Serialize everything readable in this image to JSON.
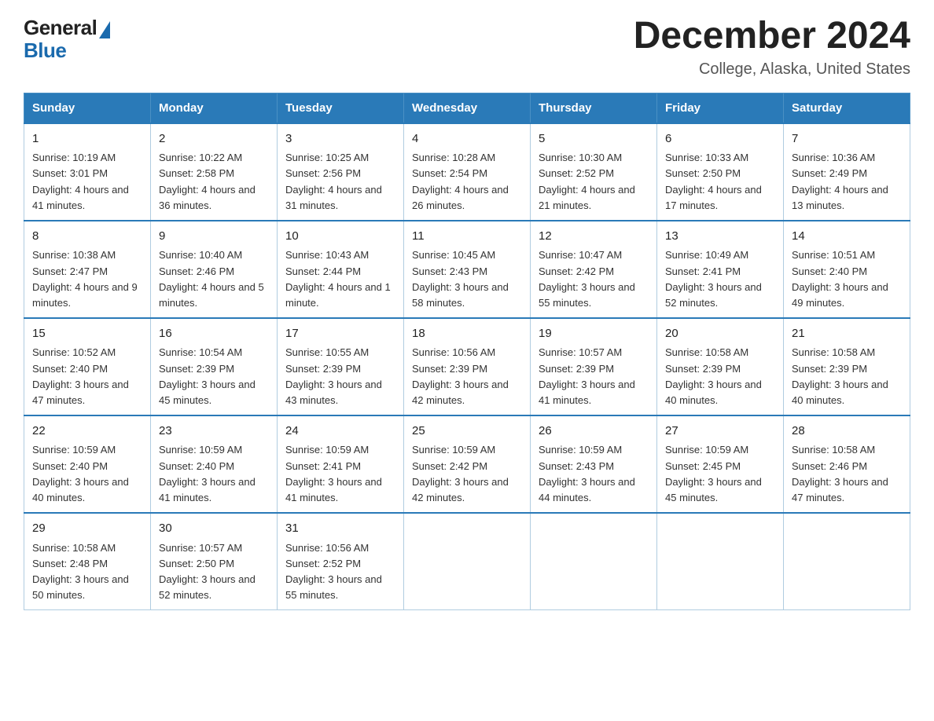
{
  "header": {
    "logo_general": "General",
    "logo_blue": "Blue",
    "title": "December 2024",
    "subtitle": "College, Alaska, United States"
  },
  "calendar": {
    "days_of_week": [
      "Sunday",
      "Monday",
      "Tuesday",
      "Wednesday",
      "Thursday",
      "Friday",
      "Saturday"
    ],
    "weeks": [
      [
        {
          "day": "1",
          "sunrise": "10:19 AM",
          "sunset": "3:01 PM",
          "daylight": "4 hours and 41 minutes."
        },
        {
          "day": "2",
          "sunrise": "10:22 AM",
          "sunset": "2:58 PM",
          "daylight": "4 hours and 36 minutes."
        },
        {
          "day": "3",
          "sunrise": "10:25 AM",
          "sunset": "2:56 PM",
          "daylight": "4 hours and 31 minutes."
        },
        {
          "day": "4",
          "sunrise": "10:28 AM",
          "sunset": "2:54 PM",
          "daylight": "4 hours and 26 minutes."
        },
        {
          "day": "5",
          "sunrise": "10:30 AM",
          "sunset": "2:52 PM",
          "daylight": "4 hours and 21 minutes."
        },
        {
          "day": "6",
          "sunrise": "10:33 AM",
          "sunset": "2:50 PM",
          "daylight": "4 hours and 17 minutes."
        },
        {
          "day": "7",
          "sunrise": "10:36 AM",
          "sunset": "2:49 PM",
          "daylight": "4 hours and 13 minutes."
        }
      ],
      [
        {
          "day": "8",
          "sunrise": "10:38 AM",
          "sunset": "2:47 PM",
          "daylight": "4 hours and 9 minutes."
        },
        {
          "day": "9",
          "sunrise": "10:40 AM",
          "sunset": "2:46 PM",
          "daylight": "4 hours and 5 minutes."
        },
        {
          "day": "10",
          "sunrise": "10:43 AM",
          "sunset": "2:44 PM",
          "daylight": "4 hours and 1 minute."
        },
        {
          "day": "11",
          "sunrise": "10:45 AM",
          "sunset": "2:43 PM",
          "daylight": "3 hours and 58 minutes."
        },
        {
          "day": "12",
          "sunrise": "10:47 AM",
          "sunset": "2:42 PM",
          "daylight": "3 hours and 55 minutes."
        },
        {
          "day": "13",
          "sunrise": "10:49 AM",
          "sunset": "2:41 PM",
          "daylight": "3 hours and 52 minutes."
        },
        {
          "day": "14",
          "sunrise": "10:51 AM",
          "sunset": "2:40 PM",
          "daylight": "3 hours and 49 minutes."
        }
      ],
      [
        {
          "day": "15",
          "sunrise": "10:52 AM",
          "sunset": "2:40 PM",
          "daylight": "3 hours and 47 minutes."
        },
        {
          "day": "16",
          "sunrise": "10:54 AM",
          "sunset": "2:39 PM",
          "daylight": "3 hours and 45 minutes."
        },
        {
          "day": "17",
          "sunrise": "10:55 AM",
          "sunset": "2:39 PM",
          "daylight": "3 hours and 43 minutes."
        },
        {
          "day": "18",
          "sunrise": "10:56 AM",
          "sunset": "2:39 PM",
          "daylight": "3 hours and 42 minutes."
        },
        {
          "day": "19",
          "sunrise": "10:57 AM",
          "sunset": "2:39 PM",
          "daylight": "3 hours and 41 minutes."
        },
        {
          "day": "20",
          "sunrise": "10:58 AM",
          "sunset": "2:39 PM",
          "daylight": "3 hours and 40 minutes."
        },
        {
          "day": "21",
          "sunrise": "10:58 AM",
          "sunset": "2:39 PM",
          "daylight": "3 hours and 40 minutes."
        }
      ],
      [
        {
          "day": "22",
          "sunrise": "10:59 AM",
          "sunset": "2:40 PM",
          "daylight": "3 hours and 40 minutes."
        },
        {
          "day": "23",
          "sunrise": "10:59 AM",
          "sunset": "2:40 PM",
          "daylight": "3 hours and 41 minutes."
        },
        {
          "day": "24",
          "sunrise": "10:59 AM",
          "sunset": "2:41 PM",
          "daylight": "3 hours and 41 minutes."
        },
        {
          "day": "25",
          "sunrise": "10:59 AM",
          "sunset": "2:42 PM",
          "daylight": "3 hours and 42 minutes."
        },
        {
          "day": "26",
          "sunrise": "10:59 AM",
          "sunset": "2:43 PM",
          "daylight": "3 hours and 44 minutes."
        },
        {
          "day": "27",
          "sunrise": "10:59 AM",
          "sunset": "2:45 PM",
          "daylight": "3 hours and 45 minutes."
        },
        {
          "day": "28",
          "sunrise": "10:58 AM",
          "sunset": "2:46 PM",
          "daylight": "3 hours and 47 minutes."
        }
      ],
      [
        {
          "day": "29",
          "sunrise": "10:58 AM",
          "sunset": "2:48 PM",
          "daylight": "3 hours and 50 minutes."
        },
        {
          "day": "30",
          "sunrise": "10:57 AM",
          "sunset": "2:50 PM",
          "daylight": "3 hours and 52 minutes."
        },
        {
          "day": "31",
          "sunrise": "10:56 AM",
          "sunset": "2:52 PM",
          "daylight": "3 hours and 55 minutes."
        },
        null,
        null,
        null,
        null
      ]
    ]
  }
}
